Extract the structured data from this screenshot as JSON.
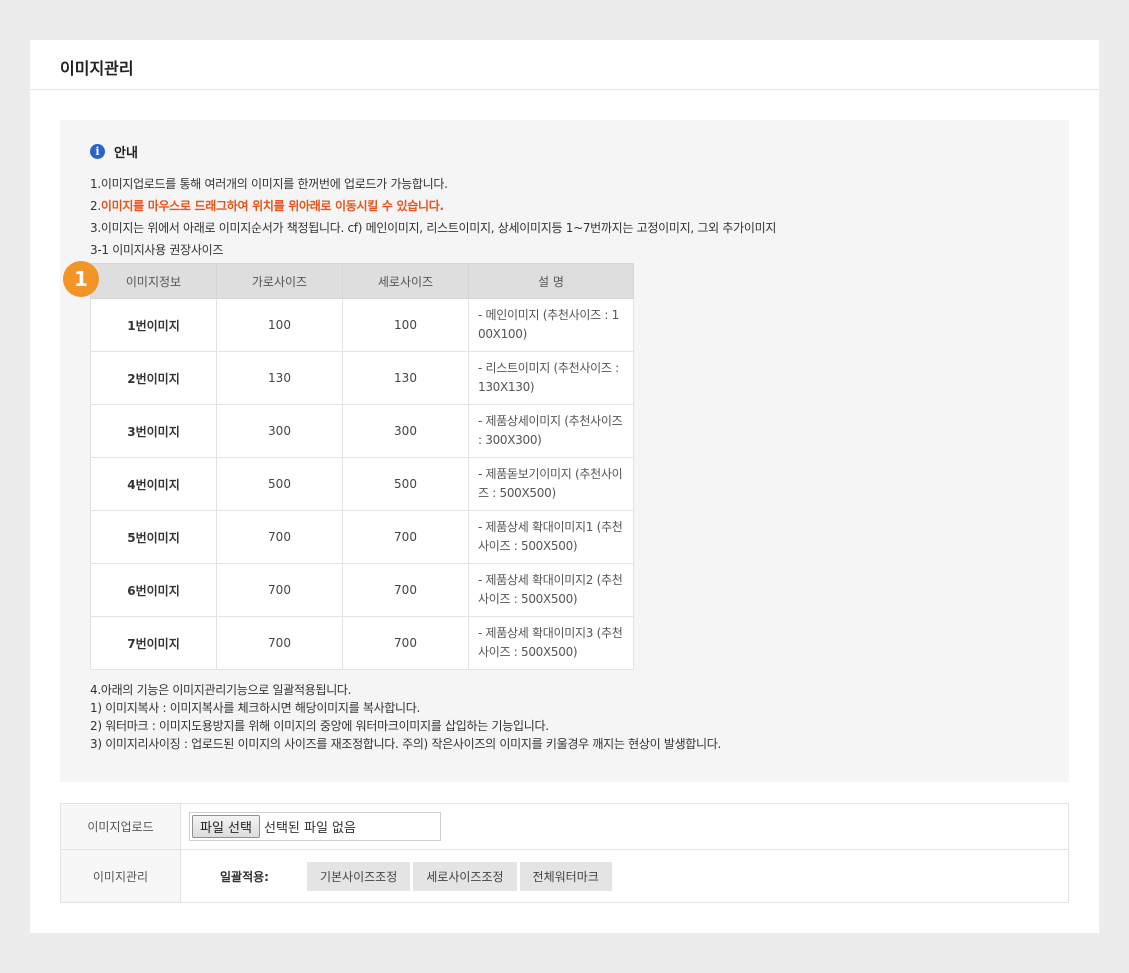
{
  "page": {
    "title": "이미지관리"
  },
  "notice": {
    "title": "안내",
    "icon": "info-icon",
    "lines_top": [
      "1.이미지업로드를 통해 여러개의 이미지를 한꺼번에 업로드가 가능합니다.",
      "이미지를 마우스로 드래그하여 위치를 위아래로 이동시킬 수 있습니다.",
      "3.이미지는 위에서 아래로 이미지순서가 책정됩니다. cf) 메인이미지, 리스트이미지, 상세이미지등 1~7번까지는 고정이미지, 그외 추가이미지",
      "3-1 이미지사용 권장사이즈"
    ],
    "warn_prefix": "2.",
    "badge": "1",
    "table": {
      "headers": [
        "이미지정보",
        "가로사이즈",
        "세로사이즈",
        "설 명"
      ],
      "rows": [
        {
          "label": "1번이미지",
          "width": "100",
          "height": "100",
          "desc": "- 메인이미지 (추천사이즈 : 100X100)"
        },
        {
          "label": "2번이미지",
          "width": "130",
          "height": "130",
          "desc": "- 리스트이미지 (추천사이즈 : 130X130)"
        },
        {
          "label": "3번이미지",
          "width": "300",
          "height": "300",
          "desc": "- 제품상세이미지 (추천사이즈 : 300X300)"
        },
        {
          "label": "4번이미지",
          "width": "500",
          "height": "500",
          "desc": "- 제품돋보기이미지 (추천사이즈 : 500X500)"
        },
        {
          "label": "5번이미지",
          "width": "700",
          "height": "700",
          "desc": "- 제품상세 확대이미지1 (추천사이즈 : 500X500)"
        },
        {
          "label": "6번이미지",
          "width": "700",
          "height": "700",
          "desc": "- 제품상세 확대이미지2 (추천사이즈 : 500X500)"
        },
        {
          "label": "7번이미지",
          "width": "700",
          "height": "700",
          "desc": "- 제품상세 확대이미지3 (추천사이즈 : 500X500)"
        }
      ]
    },
    "lines_bottom": [
      "4.아래의 기능은 이미지관리기능으로 일괄적용됩니다.",
      "1) 이미지복사 : 이미지복사를 체크하시면 해당이미지를 복사합니다.",
      "2) 워터마크 : 이미지도용방지를 위해 이미지의 중앙에 워터마크이미지를 삽입하는 기능입니다.",
      "3) 이미지리사이징 : 업로드된 이미지의 사이즈를 재조정합니다. 주의) 작은사이즈의 이미지를 키울경우 깨지는 현상이 발생합니다."
    ]
  },
  "form": {
    "upload_label": "이미지업로드",
    "file_button": "파일 선택",
    "file_status": "선택된 파일 없음",
    "manage_label": "이미지관리",
    "apply_label": "일괄적용:",
    "buttons": [
      "기본사이즈조정",
      "세로사이즈조정",
      "전체워터마크"
    ]
  },
  "colors": {
    "warn": "#e8531a",
    "badge": "#f39426",
    "info": "#2a62c9"
  }
}
